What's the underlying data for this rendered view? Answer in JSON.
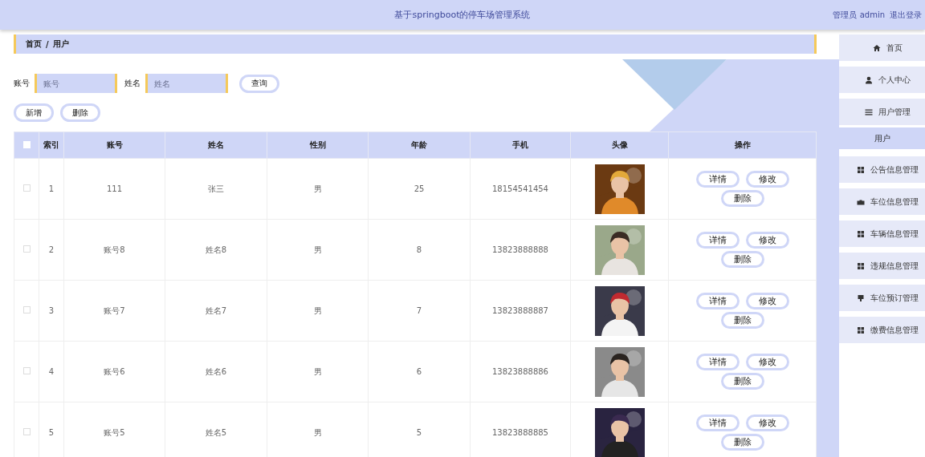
{
  "header": {
    "title": "基于springboot的停车场管理系统",
    "user": "管理员 admin",
    "logout": "退出登录"
  },
  "breadcrumb": [
    "首页",
    "/",
    "用户"
  ],
  "search": {
    "fields": [
      {
        "label": "账号",
        "placeholder": "账号"
      },
      {
        "label": "姓名",
        "placeholder": "姓名"
      }
    ],
    "button": "查询"
  },
  "actions": [
    "新增",
    "删除"
  ],
  "table": {
    "select_all": {
      "checked": false
    },
    "columns": [
      "索引",
      "账号",
      "姓名",
      "性别",
      "年龄",
      "手机",
      "头像",
      "操作"
    ],
    "rows": [
      {
        "checked": false,
        "cells": [
          "1",
          "111",
          "张三",
          "男",
          "25",
          "18154541454"
        ],
        "buttons": [
          "详情",
          "修改",
          "删除"
        ]
      },
      {
        "checked": false,
        "cells": [
          "2",
          "账号8",
          "姓名8",
          "男",
          "8",
          "13823888888"
        ],
        "buttons": [
          "详情",
          "修改",
          "删除"
        ]
      },
      {
        "checked": false,
        "cells": [
          "3",
          "账号7",
          "姓名7",
          "男",
          "7",
          "13823888887"
        ],
        "buttons": [
          "详情",
          "修改",
          "删除"
        ]
      },
      {
        "checked": false,
        "cells": [
          "4",
          "账号6",
          "姓名6",
          "男",
          "6",
          "13823888886"
        ],
        "buttons": [
          "详情",
          "修改",
          "删除"
        ]
      },
      {
        "checked": false,
        "cells": [
          "5",
          "账号5",
          "姓名5",
          "男",
          "5",
          "13823888885"
        ],
        "buttons": [
          "详情",
          "修改",
          "删除"
        ]
      }
    ]
  },
  "sidebar": {
    "items": [
      {
        "label": "首页",
        "selected": false
      },
      {
        "label": "个人中心",
        "selected": false
      },
      {
        "label": "用户管理",
        "selected": false,
        "children": [
          {
            "label": "用户",
            "selected": true
          }
        ]
      },
      {
        "label": "公告信息管理",
        "selected": false
      },
      {
        "label": "车位信息管理",
        "selected": false
      },
      {
        "label": "车辆信息管理",
        "selected": false
      },
      {
        "label": "违规信息管理",
        "selected": false
      },
      {
        "label": "车位预订管理",
        "selected": false
      },
      {
        "label": "缴费信息管理",
        "selected": false
      }
    ]
  }
}
